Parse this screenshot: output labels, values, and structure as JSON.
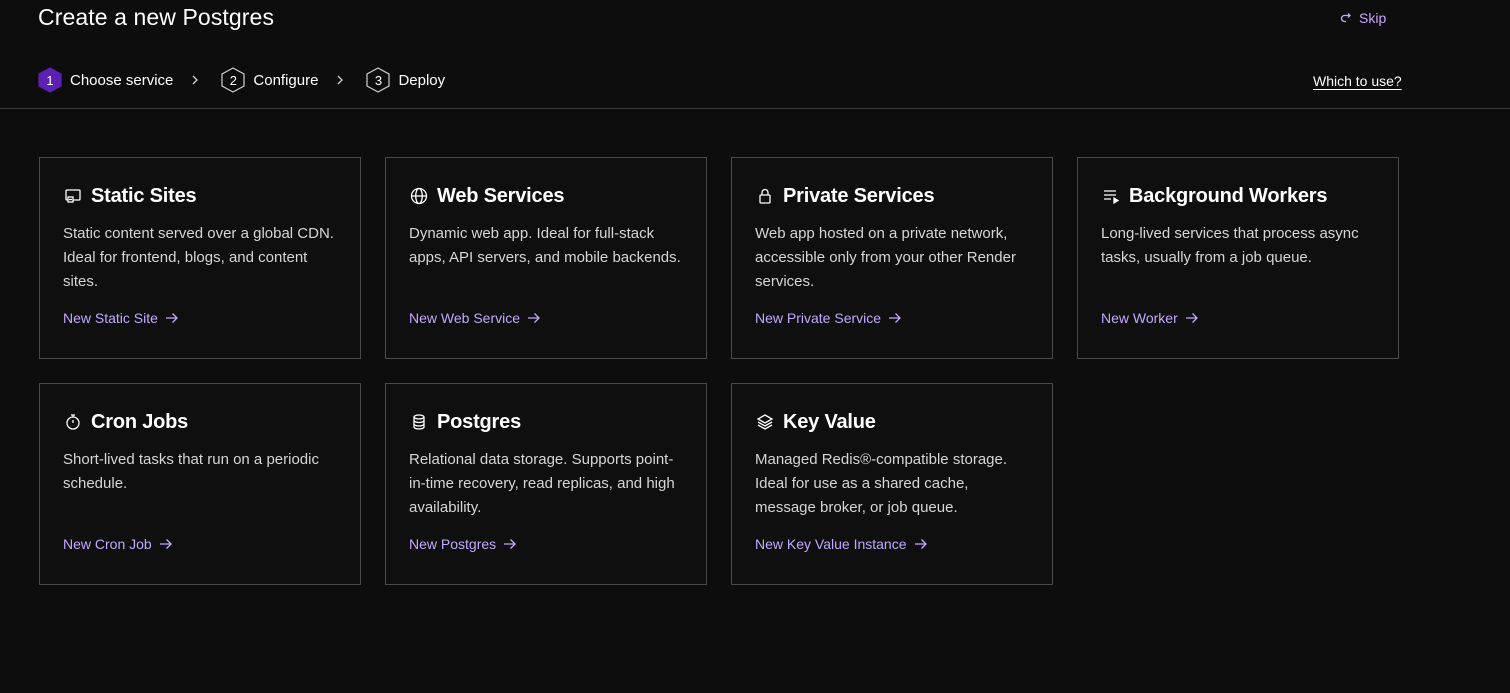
{
  "header": {
    "title": "Create a new Postgres",
    "skip_label": "Skip",
    "which_link": "Which to use?"
  },
  "stepper": {
    "steps": [
      {
        "number": "1",
        "label": "Choose service",
        "active": true
      },
      {
        "number": "2",
        "label": "Configure",
        "active": false
      },
      {
        "number": "3",
        "label": "Deploy",
        "active": false
      }
    ]
  },
  "colors": {
    "accent": "#c6a6ff",
    "active_step": "#5b21b6",
    "background": "#0d0d0d",
    "border": "#4a4a4a"
  },
  "cards": [
    {
      "icon": "static-site-icon",
      "title": "Static Sites",
      "description": "Static content served over a global CDN. Ideal for frontend, blogs, and content sites.",
      "link": "New Static Site"
    },
    {
      "icon": "globe-icon",
      "title": "Web Services",
      "description": "Dynamic web app. Ideal for full-stack apps, API servers, and mobile backends.",
      "link": "New Web Service"
    },
    {
      "icon": "lock-icon",
      "title": "Private Services",
      "description": "Web app hosted on a private network, accessible only from your other Render services.",
      "link": "New Private Service"
    },
    {
      "icon": "worker-queue-icon",
      "title": "Background Workers",
      "description": "Long-lived services that process async tasks, usually from a job queue.",
      "link": "New Worker"
    },
    {
      "icon": "stopwatch-icon",
      "title": "Cron Jobs",
      "description": "Short-lived tasks that run on a periodic schedule.",
      "link": "New Cron Job"
    },
    {
      "icon": "database-icon",
      "title": "Postgres",
      "description": "Relational data storage. Supports point-in-time recovery, read replicas, and high availability.",
      "link": "New Postgres"
    },
    {
      "icon": "layers-icon",
      "title": "Key Value",
      "description": "Managed Redis®-compatible storage. Ideal for use as a shared cache, message broker, or job queue.",
      "link": "New Key Value Instance"
    }
  ]
}
